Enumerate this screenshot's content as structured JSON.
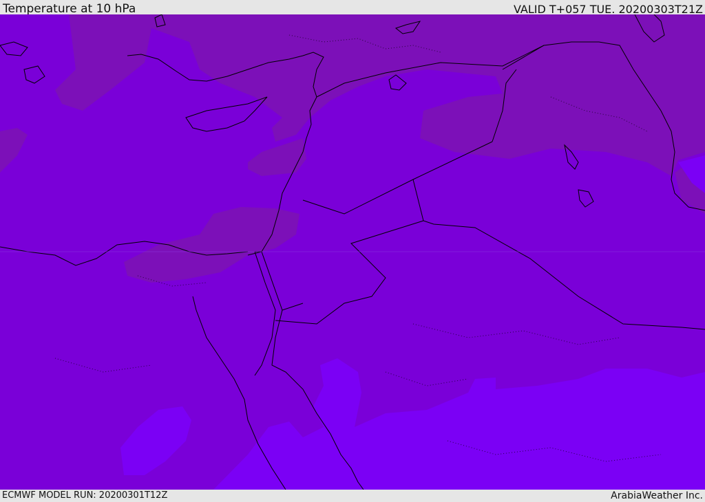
{
  "header": {
    "title": "Temperature at 10 hPa",
    "valid_time": "VALID T+057 TUE. 20200303T21Z"
  },
  "footer": {
    "model_run": "ECMWF MODEL RUN: 20200301T12Z",
    "credit": "ArabiaWeather Inc."
  },
  "colors": {
    "base": "#7a00d8",
    "colder_zone": "#7c10b8",
    "warmer_zone": "#7b00f5",
    "coastline": "#000000"
  }
}
